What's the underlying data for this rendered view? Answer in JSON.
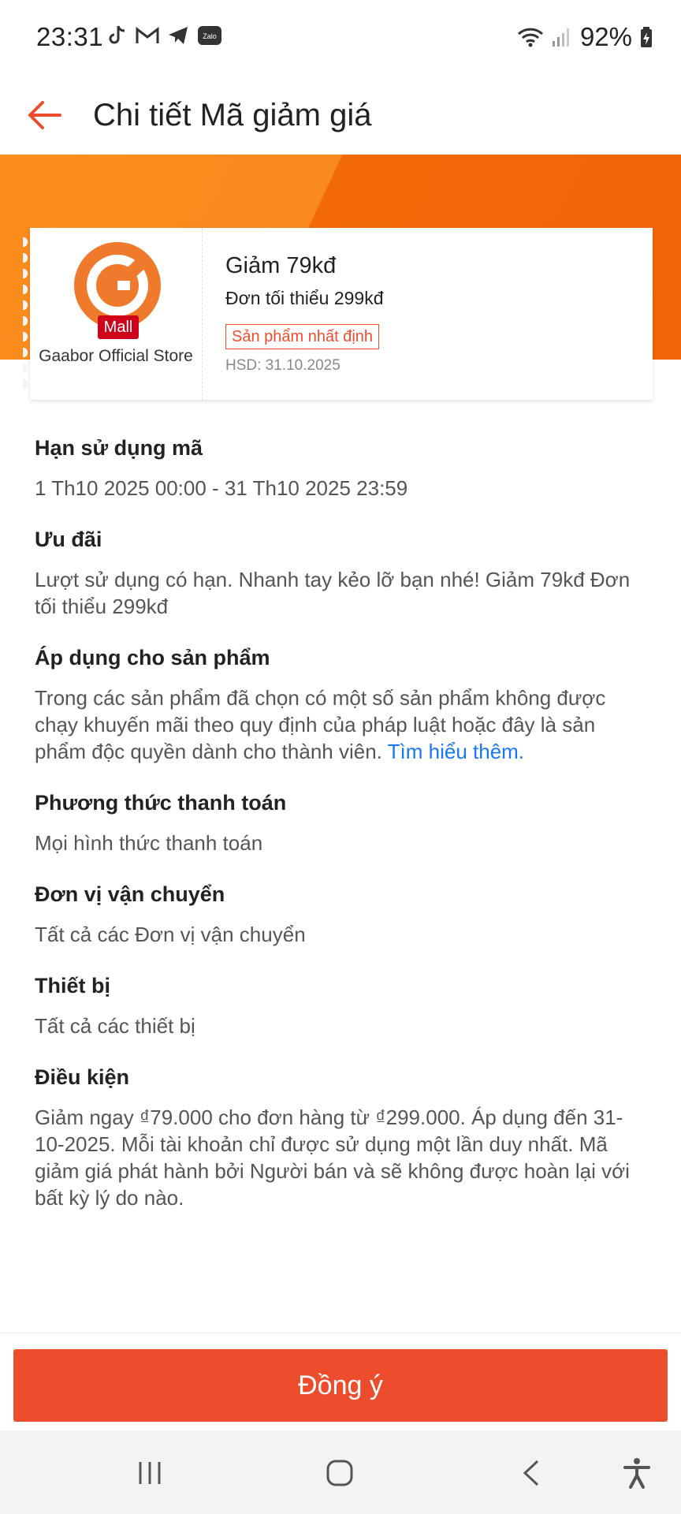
{
  "status": {
    "time": "23:31",
    "battery": "92%"
  },
  "header": {
    "title": "Chi tiết Mã giảm giá"
  },
  "voucher": {
    "badge": "Mall",
    "store": "Gaabor Official Store",
    "title": "Giảm 79kđ",
    "min_order": "Đơn tối thiểu 299kđ",
    "tag": "Sản phẩm nhất định",
    "expiry": "HSD: 31.10.2025"
  },
  "sections": [
    {
      "title": "Hạn sử dụng mã",
      "body": "1 Th10 2025 00:00 - 31 Th10 2025 23:59"
    },
    {
      "title": "Ưu đãi",
      "body": "Lượt sử dụng có hạn. Nhanh tay kẻo lỡ bạn nhé! Giảm 79kđ Đơn tối thiểu 299kđ"
    },
    {
      "title": "Áp dụng cho sản phẩm",
      "body": "Trong các sản phẩm đã chọn có một số sản phẩm không được chạy khuyến mãi theo quy định của pháp luật hoặc đây là sản phẩm độc quyền dành cho thành viên. ",
      "link": "Tìm hiểu thêm."
    },
    {
      "title": "Phương thức thanh toán",
      "body": "Mọi hình thức thanh toán"
    },
    {
      "title": "Đơn vị vận chuyển",
      "body": "Tất cả các Đơn vị vận chuyển"
    },
    {
      "title": "Thiết bị",
      "body": "Tất cả các thiết bị"
    },
    {
      "title": "Điều kiện",
      "body": "Giảm ngay ₫79.000 cho đơn hàng từ ₫299.000. Áp dụng đến 31-10-2025. Mỗi tài khoản chỉ được sử dụng một lần duy nhất. Mã giảm giá phát hành bởi Người bán và sẽ không được hoàn lại với bất kỳ lý do nào."
    }
  ],
  "footer": {
    "agree_label": "Đồng ý"
  },
  "colors": {
    "primary": "#ee4d2d",
    "banner": "#f26a08",
    "link": "#1877f2"
  }
}
